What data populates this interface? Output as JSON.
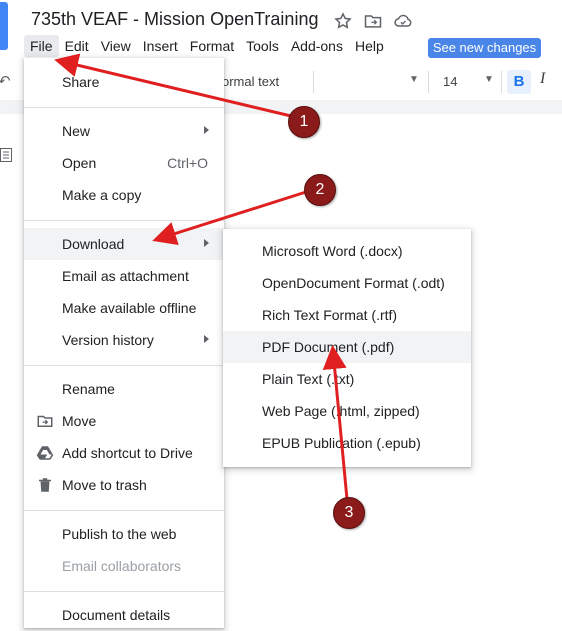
{
  "doc_title": "735th VEAF - Mission OpenTraining",
  "menubar": {
    "items": [
      "File",
      "Edit",
      "View",
      "Insert",
      "Format",
      "Tools",
      "Add-ons",
      "Help"
    ],
    "see_changes_label": "See new changes"
  },
  "toolbar": {
    "style_value": "ormal text",
    "font_size_value": "14",
    "bold_label": "B",
    "italic_label": "I"
  },
  "file_menu": {
    "share": "Share",
    "new": "New",
    "open": "Open",
    "open_shortcut": "Ctrl+O",
    "make_copy": "Make a copy",
    "download": "Download",
    "email_attachment": "Email as attachment",
    "make_offline": "Make available offline",
    "version_history": "Version history",
    "rename": "Rename",
    "move": "Move",
    "add_shortcut": "Add shortcut to Drive",
    "move_trash": "Move to trash",
    "publish_web": "Publish to the web",
    "email_collaborators": "Email collaborators",
    "document_details": "Document details"
  },
  "download_submenu": {
    "items": [
      "Microsoft Word (.docx)",
      "OpenDocument Format (.odt)",
      "Rich Text Format (.rtf)",
      "PDF Document (.pdf)",
      "Plain Text (.txt)",
      "Web Page (.html, zipped)",
      "EPUB Publication (.epub)"
    ]
  },
  "annotations": {
    "badges": [
      "1",
      "2",
      "3"
    ],
    "arrow_color": "#e02020",
    "badge_color": "#8b1a1a"
  }
}
